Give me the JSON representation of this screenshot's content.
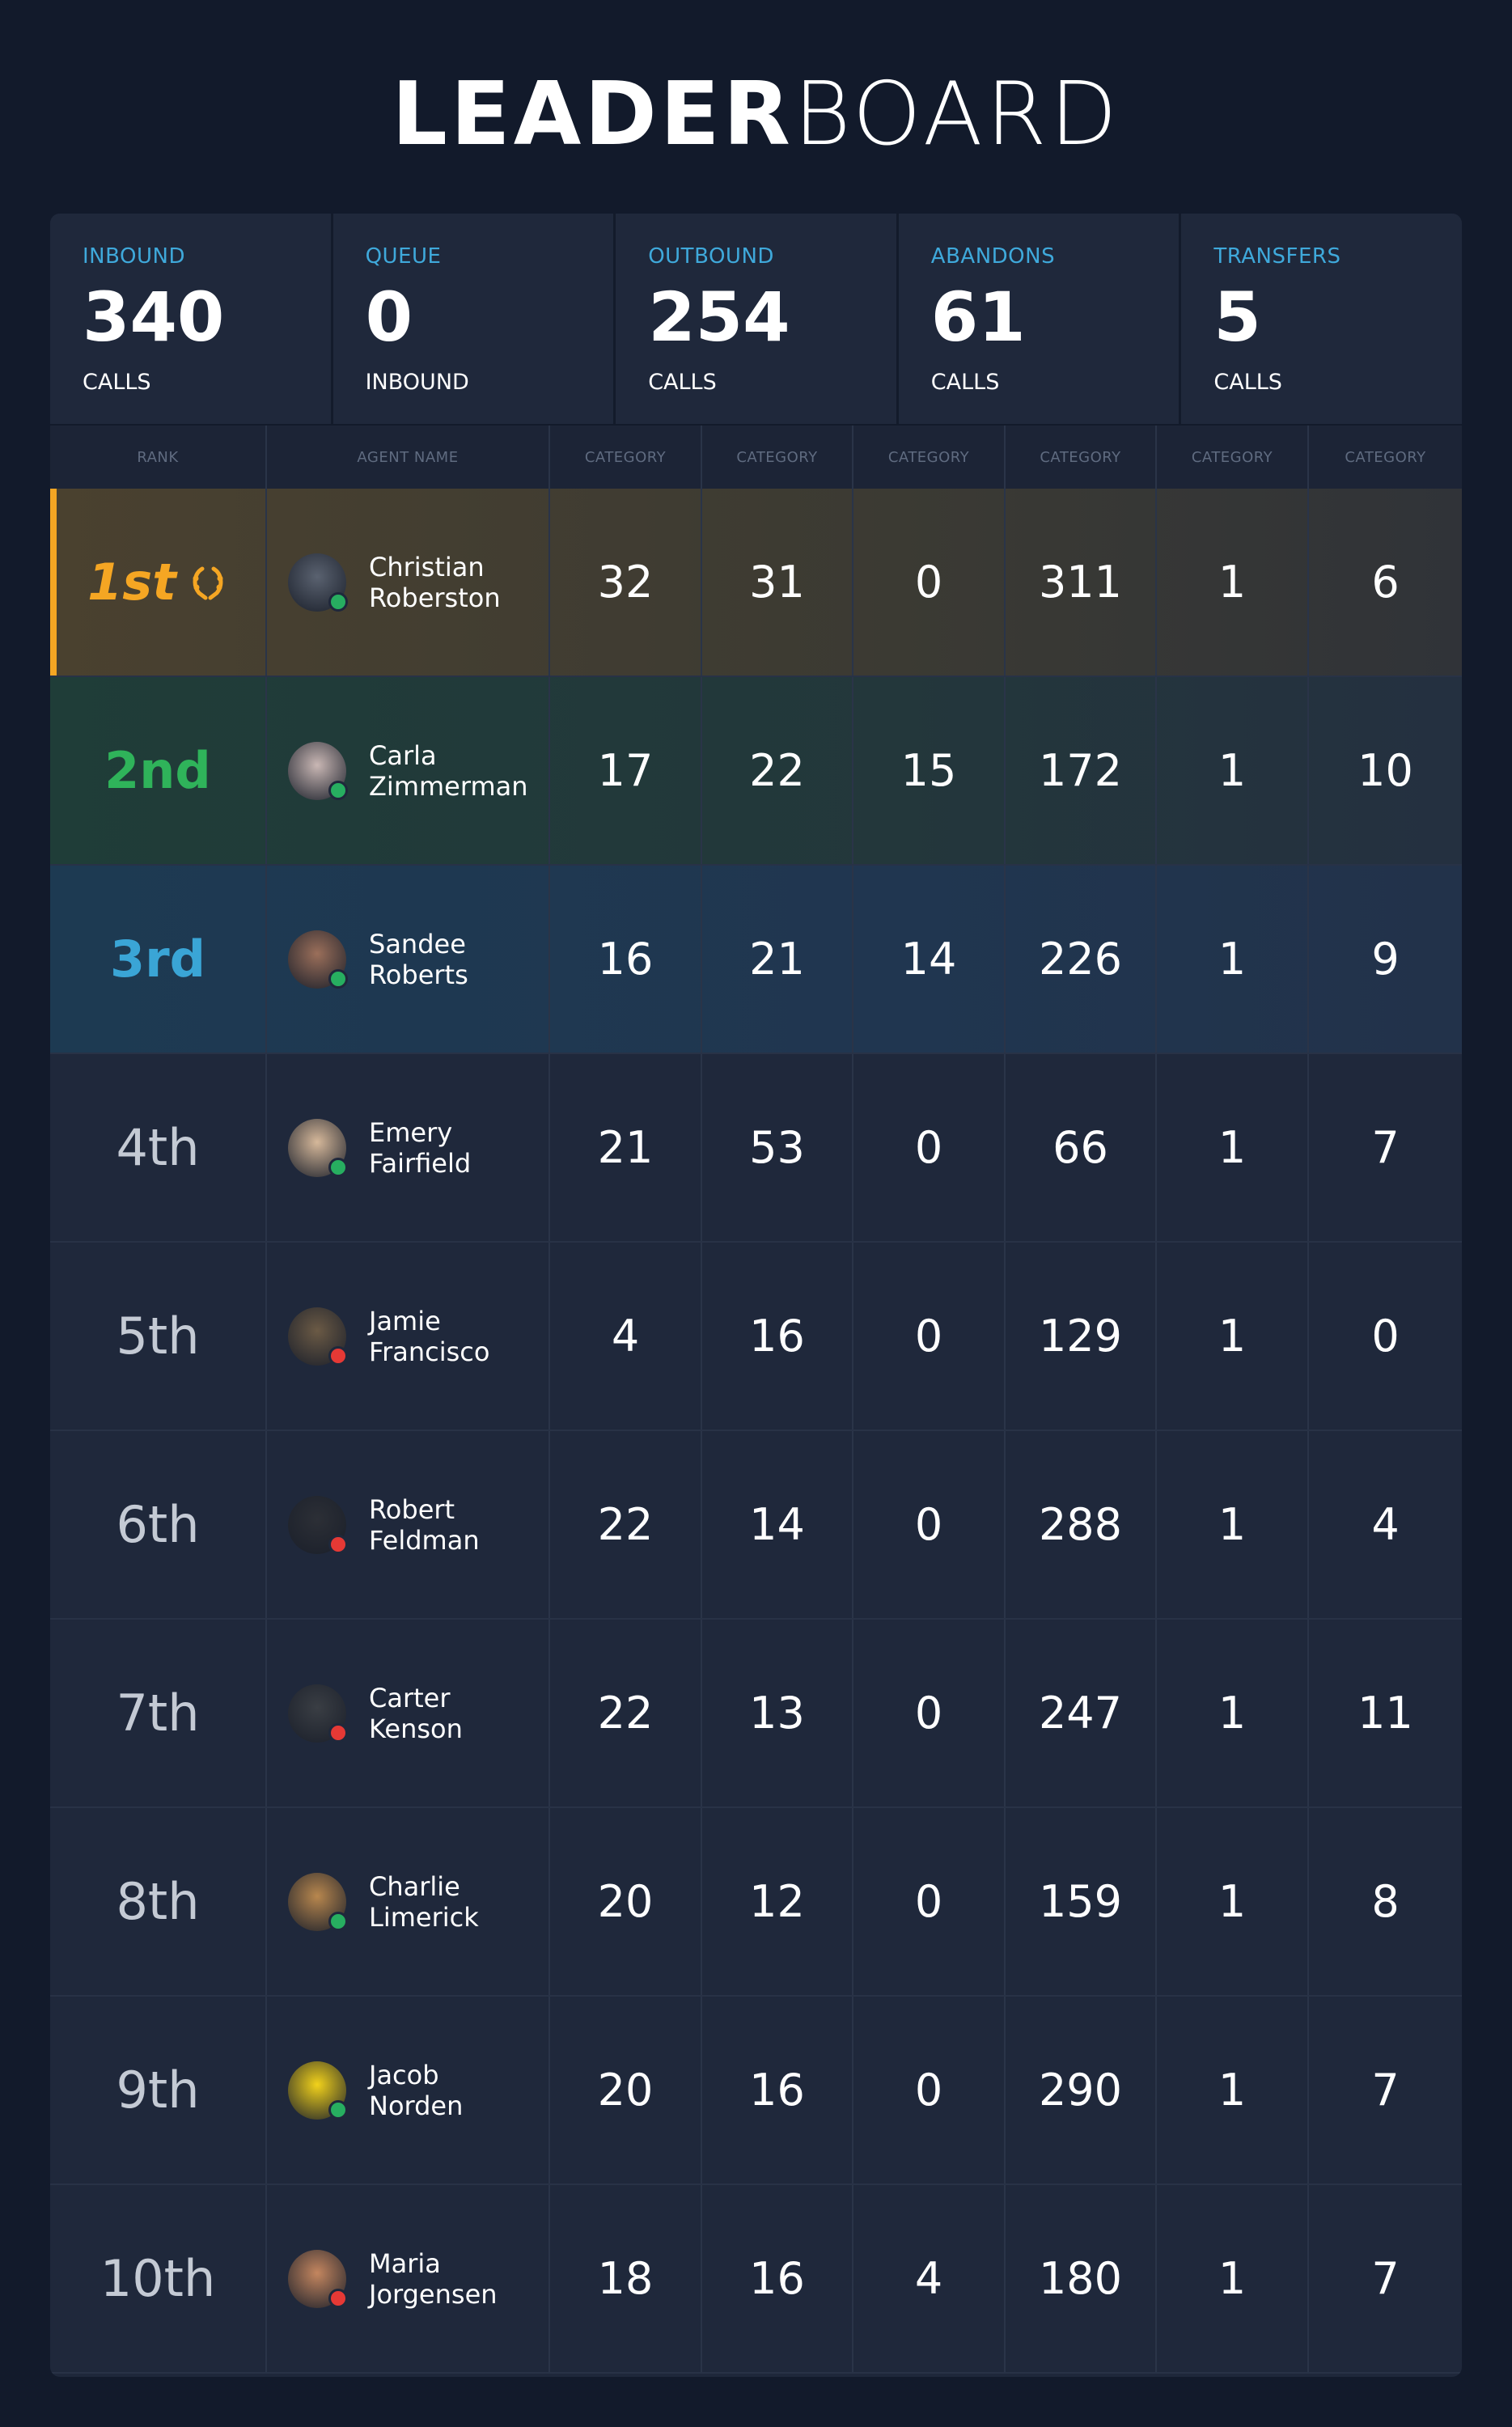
{
  "title": {
    "bold": "LEADER",
    "light": "BOARD"
  },
  "stats": [
    {
      "label": "INBOUND",
      "value": "340",
      "unit": "CALLS"
    },
    {
      "label": "QUEUE",
      "value": "0",
      "unit": "INBOUND"
    },
    {
      "label": "OUTBOUND",
      "value": "254",
      "unit": "CALLS"
    },
    {
      "label": "ABANDONS",
      "value": "61",
      "unit": "CALLS"
    },
    {
      "label": "TRANSFERS",
      "value": "5",
      "unit": "CALLS"
    }
  ],
  "headers": [
    "RANK",
    "AGENT NAME",
    "CATEGORY",
    "CATEGORY",
    "CATEGORY",
    "CATEGORY",
    "CATEGORY",
    "CATEGORY"
  ],
  "rows": [
    {
      "rank": "1st",
      "first": "Christian",
      "last": "Roberston",
      "status": "online",
      "avatar_color": "#5a6270",
      "values": [
        "32",
        "31",
        "0",
        "311",
        "1",
        "6"
      ]
    },
    {
      "rank": "2nd",
      "first": "Carla",
      "last": "Zimmerman",
      "status": "online",
      "avatar_color": "#c9b7b4",
      "values": [
        "17",
        "22",
        "15",
        "172",
        "1",
        "10"
      ]
    },
    {
      "rank": "3rd",
      "first": "Sandee",
      "last": "Roberts",
      "status": "online",
      "avatar_color": "#9b6f5a",
      "values": [
        "16",
        "21",
        "14",
        "226",
        "1",
        "9"
      ]
    },
    {
      "rank": "4th",
      "first": "Emery",
      "last": "Fairfield",
      "status": "online",
      "avatar_color": "#d6b89a",
      "values": [
        "21",
        "53",
        "0",
        "66",
        "1",
        "7"
      ]
    },
    {
      "rank": "5th",
      "first": "Jamie",
      "last": "Francisco",
      "status": "offline",
      "avatar_color": "#6b5a45",
      "values": [
        "4",
        "16",
        "0",
        "129",
        "1",
        "0"
      ]
    },
    {
      "rank": "6th",
      "first": "Robert",
      "last": "Feldman",
      "status": "offline",
      "avatar_color": "#2c2f36",
      "values": [
        "22",
        "14",
        "0",
        "288",
        "1",
        "4"
      ]
    },
    {
      "rank": "7th",
      "first": "Carter",
      "last": "Kenson",
      "status": "offline",
      "avatar_color": "#3a3e44",
      "values": [
        "22",
        "13",
        "0",
        "247",
        "1",
        "11"
      ]
    },
    {
      "rank": "8th",
      "first": "Charlie",
      "last": "Limerick",
      "status": "online",
      "avatar_color": "#b8874e",
      "values": [
        "20",
        "12",
        "0",
        "159",
        "1",
        "8"
      ]
    },
    {
      "rank": "9th",
      "first": "Jacob",
      "last": "Norden",
      "status": "online",
      "avatar_color": "#f2d21b",
      "values": [
        "20",
        "16",
        "0",
        "290",
        "1",
        "7"
      ]
    },
    {
      "rank": "10th",
      "first": "Maria",
      "last": "Jorgensen",
      "status": "offline",
      "avatar_color": "#c4865f",
      "values": [
        "18",
        "16",
        "4",
        "180",
        "1",
        "7"
      ]
    }
  ],
  "colors": {
    "online": "#27ae60",
    "offline": "#e53935",
    "gold": "#f5a623",
    "silver_green": "#2fb35a",
    "blue": "#3aa5d6"
  }
}
